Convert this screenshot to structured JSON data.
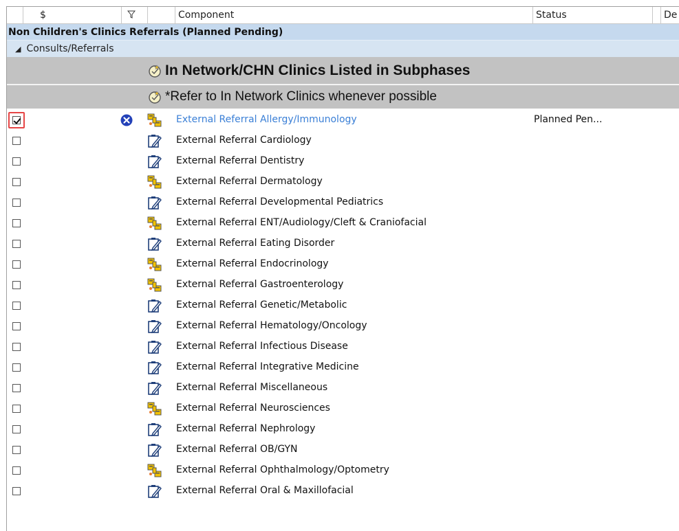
{
  "header": {
    "cost_symbol": "$",
    "component_label": "Component",
    "status_label": "Status",
    "details_label": "De"
  },
  "phase": {
    "title": "Non Children's Clinics Referrals (Planned Pending)"
  },
  "subsection": {
    "label": "Consults/Referrals"
  },
  "notes": [
    {
      "text": "In Network/CHN Clinics Listed in Subphases",
      "icon": "note-star-icon"
    },
    {
      "text": "*Refer to In Network Clinics whenever possible",
      "icon": "note-star-icon"
    }
  ],
  "colors": {
    "phase_band": "#c5d9ee",
    "sub_band": "#d6e4f2",
    "note_band": "#c2c2c2",
    "link": "#3a7fd6",
    "highlight": "#e64545"
  },
  "rows": [
    {
      "label": "External Referral Allergy/Immunology",
      "icon": "careset-icon",
      "checked": true,
      "status": "Planned Pen...",
      "removable": true,
      "link": true
    },
    {
      "label": "External Referral Cardiology",
      "icon": "order-pencil-icon",
      "checked": false,
      "status": "",
      "removable": false,
      "link": false
    },
    {
      "label": "External Referral Dentistry",
      "icon": "order-pencil-icon",
      "checked": false,
      "status": "",
      "removable": false,
      "link": false
    },
    {
      "label": "External Referral Dermatology",
      "icon": "careset-icon",
      "checked": false,
      "status": "",
      "removable": false,
      "link": false
    },
    {
      "label": "External Referral Developmental Pediatrics",
      "icon": "order-pencil-icon",
      "checked": false,
      "status": "",
      "removable": false,
      "link": false
    },
    {
      "label": "External Referral ENT/Audiology/Cleft & Craniofacial",
      "icon": "careset-icon",
      "checked": false,
      "status": "",
      "removable": false,
      "link": false
    },
    {
      "label": "External Referral Eating Disorder",
      "icon": "order-pencil-icon",
      "checked": false,
      "status": "",
      "removable": false,
      "link": false
    },
    {
      "label": "External Referral Endocrinology",
      "icon": "careset-icon",
      "checked": false,
      "status": "",
      "removable": false,
      "link": false
    },
    {
      "label": "External Referral Gastroenterology",
      "icon": "careset-icon",
      "checked": false,
      "status": "",
      "removable": false,
      "link": false
    },
    {
      "label": "External Referral Genetic/Metabolic",
      "icon": "order-pencil-icon",
      "checked": false,
      "status": "",
      "removable": false,
      "link": false
    },
    {
      "label": "External Referral Hematology/Oncology",
      "icon": "order-pencil-icon",
      "checked": false,
      "status": "",
      "removable": false,
      "link": false
    },
    {
      "label": "External Referral Infectious Disease",
      "icon": "order-pencil-icon",
      "checked": false,
      "status": "",
      "removable": false,
      "link": false
    },
    {
      "label": "External Referral Integrative Medicine",
      "icon": "order-pencil-icon",
      "checked": false,
      "status": "",
      "removable": false,
      "link": false
    },
    {
      "label": "External Referral Miscellaneous",
      "icon": "order-pencil-icon",
      "checked": false,
      "status": "",
      "removable": false,
      "link": false
    },
    {
      "label": "External Referral Neurosciences",
      "icon": "careset-icon",
      "checked": false,
      "status": "",
      "removable": false,
      "link": false
    },
    {
      "label": "External Referral Nephrology",
      "icon": "order-pencil-icon",
      "checked": false,
      "status": "",
      "removable": false,
      "link": false
    },
    {
      "label": "External Referral OB/GYN",
      "icon": "order-pencil-icon",
      "checked": false,
      "status": "",
      "removable": false,
      "link": false
    },
    {
      "label": "External Referral Ophthalmology/Optometry",
      "icon": "careset-icon",
      "checked": false,
      "status": "",
      "removable": false,
      "link": false
    },
    {
      "label": "External Referral Oral & Maxillofacial",
      "icon": "order-pencil-icon",
      "checked": false,
      "status": "",
      "removable": false,
      "link": false
    }
  ]
}
